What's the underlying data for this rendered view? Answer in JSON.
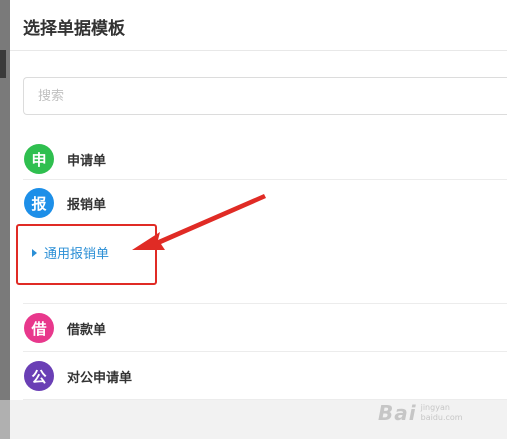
{
  "dialog": {
    "title": "选择单据模板"
  },
  "search": {
    "placeholder": "搜索"
  },
  "templates": [
    {
      "badge": "申",
      "label": "申请单",
      "color": "#2fbf4f"
    },
    {
      "badge": "报",
      "label": "报销单",
      "color": "#1d8fe8"
    },
    {
      "badge": "借",
      "label": "借款单",
      "color": "#e8388c"
    },
    {
      "badge": "公",
      "label": "对公申请单",
      "color": "#6a3fb5"
    }
  ],
  "expanded": {
    "label": "通用报销单"
  },
  "annotation": {
    "box_color": "#e02b25",
    "arrow_color": "#e02b25"
  },
  "watermark": {
    "brand": "Bai",
    "sub_line1": "jingyan",
    "sub_line2": "baidu.com"
  }
}
